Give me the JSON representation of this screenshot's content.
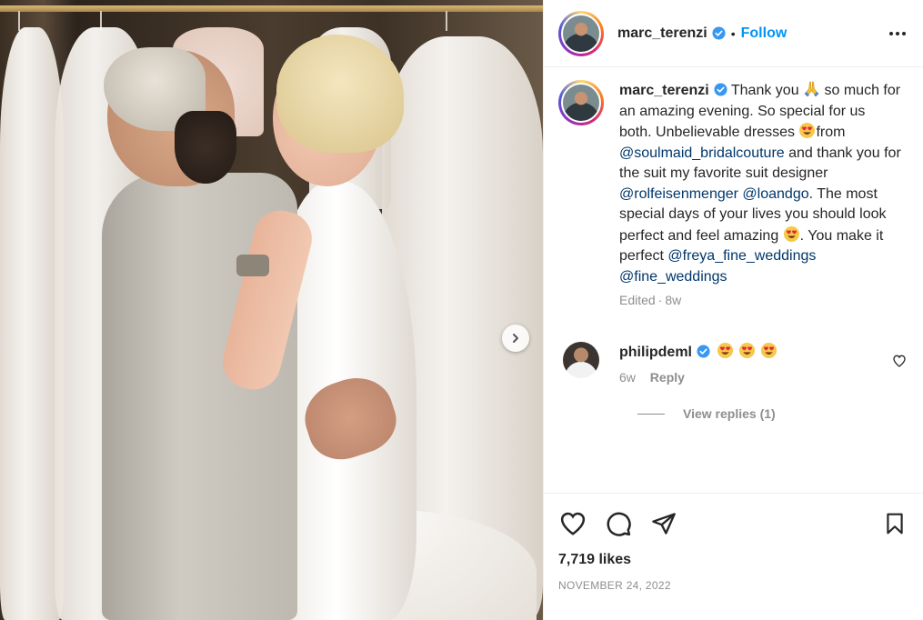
{
  "post": {
    "username": "marc_terenzi",
    "follow_label": "Follow",
    "dot": "•"
  },
  "caption": {
    "username": "marc_terenzi",
    "part1": "Thank you",
    "part2": "so much for an amazing evening. So special for us both. Unbelievable dresses",
    "part3": "from",
    "mention1": "@soulmaid_bridalcouture",
    "part4": "and thank you for the suit my favorite suit designer",
    "mention2": "@rolfeisenmenger",
    "mention3": "@loandgo",
    "part5": ". The most special days of your lives you should look perfect and feel amazing",
    "part6": ". You make it perfect",
    "mention4": "@freya_fine_weddings",
    "mention5": "@fine_weddings",
    "edited": "Edited",
    "sep": "·",
    "age": "8w"
  },
  "comment": {
    "username": "philipdeml",
    "age": "6w",
    "reply_label": "Reply",
    "view_replies": "View replies (1)"
  },
  "stats": {
    "likes": "7,719 likes",
    "date": "NOVEMBER 24, 2022"
  },
  "icons": {
    "verified": "verified-badge-icon",
    "more": "more-options-icon",
    "next": "chevron-right-icon",
    "heart": "heart-icon",
    "comment": "comment-icon",
    "share": "paper-plane-icon",
    "save": "bookmark-icon",
    "pray": "folded-hands-emoji",
    "heart_eyes": "heart-eyes-emoji"
  },
  "colors": {
    "accent": "#0095f6",
    "mention": "#00376b",
    "muted": "#8e8e8e",
    "verified": "#3897f0"
  }
}
